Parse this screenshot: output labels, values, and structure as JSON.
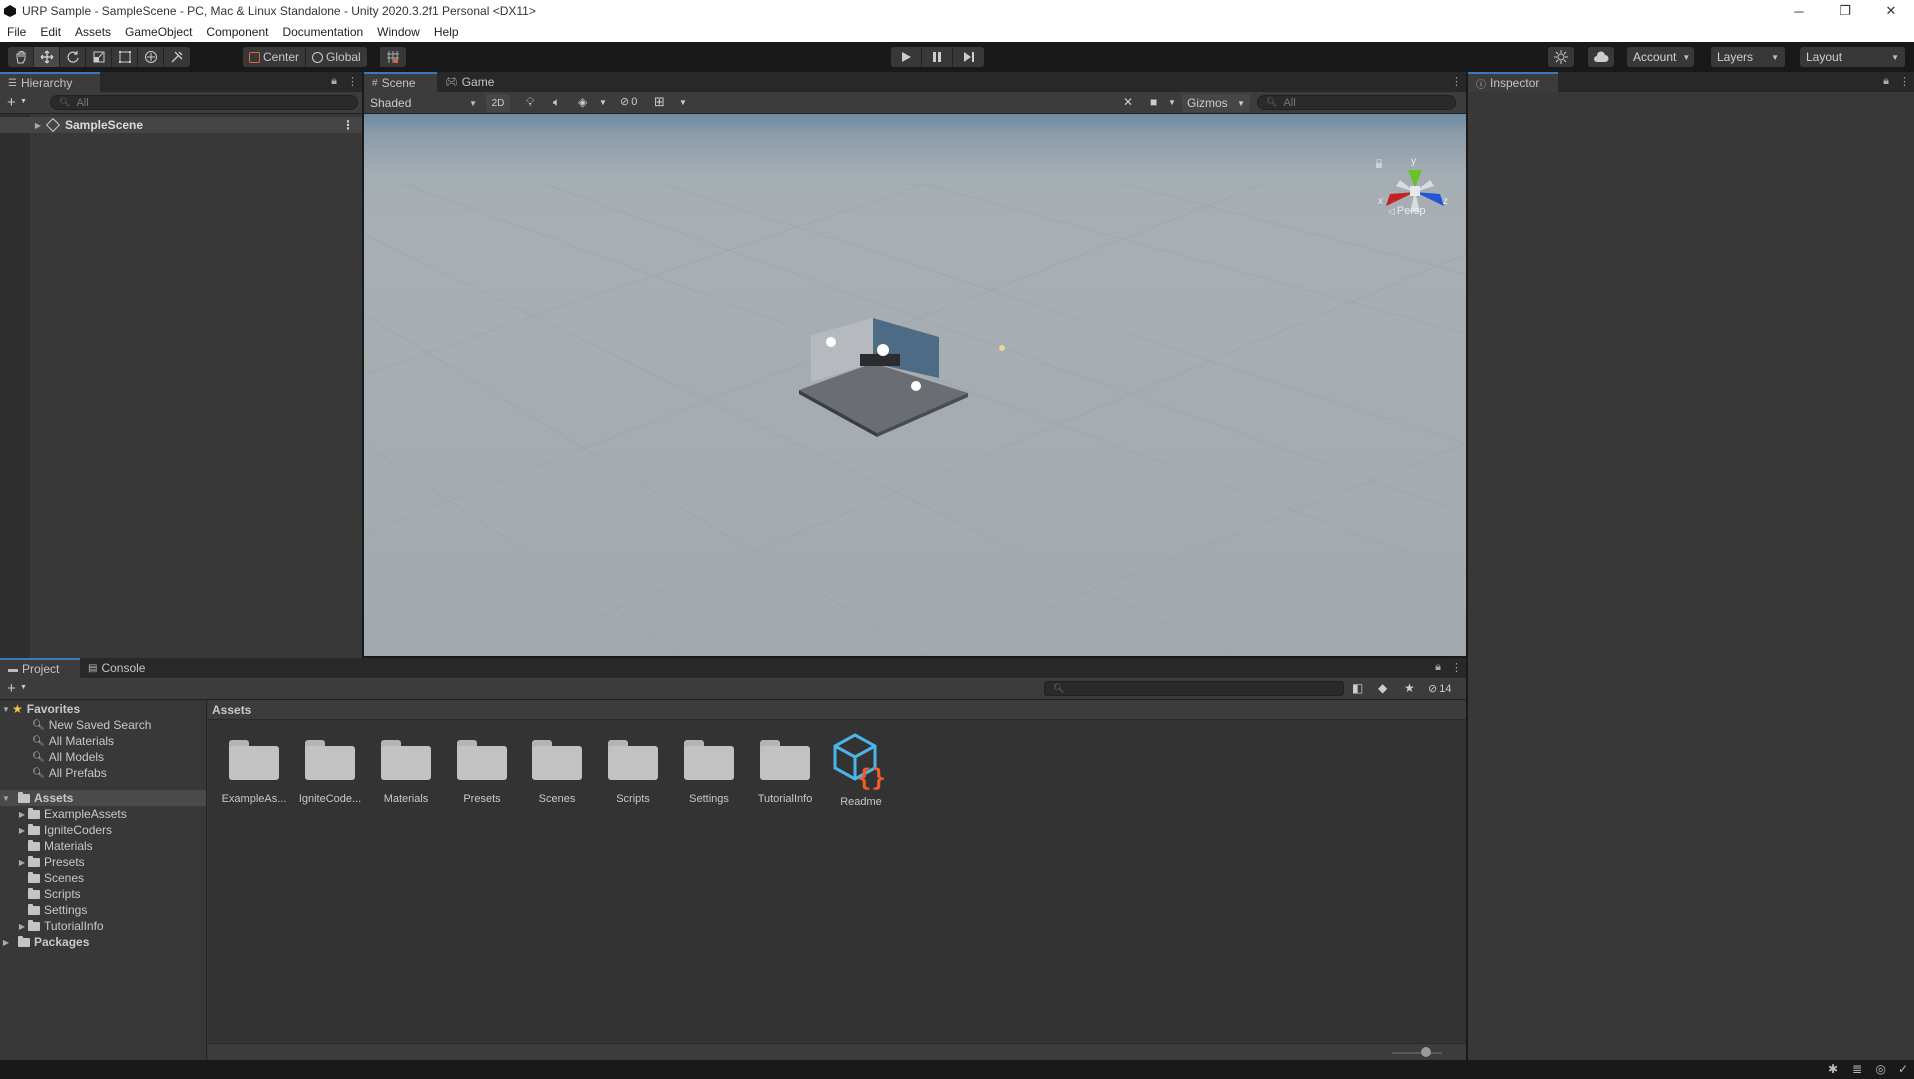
{
  "window": {
    "title": "URP Sample - SampleScene - PC, Mac & Linux Standalone - Unity 2020.3.2f1 Personal <DX11>",
    "minimize": "─",
    "restore": "❐",
    "close": "✕"
  },
  "menu": [
    "File",
    "Edit",
    "Assets",
    "GameObject",
    "Component",
    "Documentation",
    "Window",
    "Help"
  ],
  "toolbar": {
    "pivot_label": "Center",
    "space_label": "Global",
    "account_label": "Account",
    "layers_label": "Layers",
    "layout_label": "Layout"
  },
  "hierarchy": {
    "tab_label": "Hierarchy",
    "search_placeholder": "All",
    "scene_name": "SampleScene"
  },
  "scene_view": {
    "tabs": [
      "Scene",
      "Game"
    ],
    "draw_mode": "Shaded",
    "mode_2d": "2D",
    "hidden_count": "0",
    "gizmos_label": "Gizmos",
    "search_placeholder": "All",
    "gizmo_axes": {
      "y": "y",
      "x": "x",
      "z": "z"
    },
    "projection_label": "Persp"
  },
  "inspector": {
    "tab_label": "Inspector"
  },
  "project": {
    "tabs": [
      "Project",
      "Console"
    ],
    "hidden_count": "14",
    "breadcrumb": "Assets",
    "favorites": {
      "label": "Favorites",
      "items": [
        "New Saved Search",
        "All Materials",
        "All Models",
        "All Prefabs"
      ]
    },
    "tree": {
      "root_label": "Assets",
      "children": [
        {
          "label": "ExampleAssets",
          "expandable": true
        },
        {
          "label": "IgniteCoders",
          "expandable": true
        },
        {
          "label": "Materials",
          "expandable": false
        },
        {
          "label": "Presets",
          "expandable": true
        },
        {
          "label": "Scenes",
          "expandable": false
        },
        {
          "label": "Scripts",
          "expandable": false
        },
        {
          "label": "Settings",
          "expandable": false
        },
        {
          "label": "TutorialInfo",
          "expandable": true
        }
      ],
      "packages_label": "Packages"
    },
    "assets": [
      {
        "label": "ExampleAs...",
        "kind": "folder"
      },
      {
        "label": "IgniteCode...",
        "kind": "folder"
      },
      {
        "label": "Materials",
        "kind": "folder"
      },
      {
        "label": "Presets",
        "kind": "folder"
      },
      {
        "label": "Scenes",
        "kind": "folder"
      },
      {
        "label": "Scripts",
        "kind": "folder"
      },
      {
        "label": "Settings",
        "kind": "folder"
      },
      {
        "label": "TutorialInfo",
        "kind": "folder"
      },
      {
        "label": "Readme",
        "kind": "readme-asset"
      }
    ]
  },
  "colors": {
    "accent": "#3a79bb",
    "gizmo_y": "#6cc12b",
    "gizmo_x": "#c22424",
    "gizmo_z": "#2255d8",
    "readme_cube": "#4bb5e8",
    "readme_braces": "#f05c2c"
  }
}
